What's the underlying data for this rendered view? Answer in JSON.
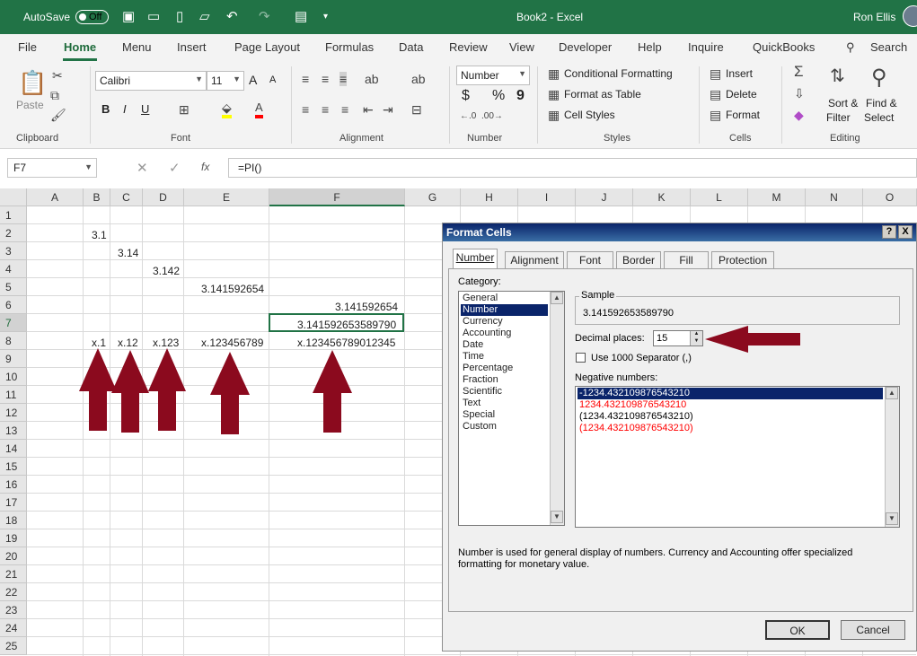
{
  "titlebar": {
    "autosave": "AutoSave",
    "toggle": "Off",
    "title": "Book2 - Excel",
    "user": "Ron Ellis"
  },
  "tabs": [
    "File",
    "Home",
    "Menu",
    "Insert",
    "Page Layout",
    "Formulas",
    "Data",
    "Review",
    "View",
    "Developer",
    "Help",
    "Inquire",
    "QuickBooks"
  ],
  "search_label": "Search",
  "ribbon": {
    "clipboard": {
      "paste": "Paste",
      "group": "Clipboard"
    },
    "font": {
      "name": "Calibri",
      "size": "11",
      "bold": "B",
      "italic": "I",
      "underline": "U",
      "grow": "A",
      "shrink": "A",
      "group": "Font"
    },
    "alignment": {
      "group": "Alignment"
    },
    "number": {
      "format": "Number",
      "currency": "$",
      "percent": "%",
      "comma": "9",
      "group": "Number"
    },
    "styles": {
      "conditional": "Conditional Formatting",
      "table": "Format as Table",
      "cell_styles": "Cell Styles",
      "group": "Styles"
    },
    "cells": {
      "insert": "Insert",
      "delete": "Delete",
      "format": "Format",
      "group": "Cells"
    },
    "editing": {
      "sort": "Sort &",
      "filter": "Filter",
      "find": "Find &",
      "select": "Select",
      "group": "Editing"
    }
  },
  "formula_bar": {
    "name_box": "F7",
    "fx": "fx",
    "formula": "=PI()"
  },
  "columns": [
    "A",
    "B",
    "C",
    "D",
    "E",
    "F",
    "G",
    "H",
    "I",
    "J",
    "K",
    "L",
    "M",
    "N",
    "O"
  ],
  "rows": [
    "1",
    "2",
    "3",
    "4",
    "5",
    "6",
    "7",
    "8",
    "9",
    "10",
    "11",
    "12",
    "13",
    "14",
    "15",
    "16",
    "17",
    "18",
    "19",
    "20",
    "21",
    "22",
    "23",
    "24",
    "25"
  ],
  "cells": {
    "B2": "3.1",
    "C3": "3.14",
    "D4": "3.142",
    "E5": "3.141592654",
    "F6": "3.141592654",
    "F7": "3.141592653589790",
    "B8": "x.1",
    "C8": "x.12",
    "D8": "x.123",
    "E8": "x.123456789",
    "F8": "x.123456789012345"
  },
  "dialog": {
    "title": "Format Cells",
    "help": "?",
    "close": "X",
    "tabs": [
      "Number",
      "Alignment",
      "Font",
      "Border",
      "Fill",
      "Protection"
    ],
    "category_label": "Category:",
    "categories": [
      "General",
      "Number",
      "Currency",
      "Accounting",
      "Date",
      "Time",
      "Percentage",
      "Fraction",
      "Scientific",
      "Text",
      "Special",
      "Custom"
    ],
    "selected_category": "Number",
    "sample_label": "Sample",
    "sample_value": "3.141592653589790",
    "decimal_label": "Decimal places:",
    "decimal_value": "15",
    "separator_label": "Use 1000 Separator (,)",
    "negative_label": "Negative numbers:",
    "negatives": [
      "-1234.432109876543210",
      "1234.432109876543210",
      "(1234.432109876543210)",
      "(1234.432109876543210)"
    ],
    "negative_colors": [
      "#ffffff",
      "#ff0000",
      "#000000",
      "#ff0000"
    ],
    "description": "Number is used for general display of numbers.  Currency and Accounting offer specialized formatting for monetary value.",
    "ok": "OK",
    "cancel": "Cancel"
  },
  "colors": {
    "excel_green": "#217346",
    "arrow": "#8b0a1e",
    "dialog_title": "#0a246a"
  }
}
